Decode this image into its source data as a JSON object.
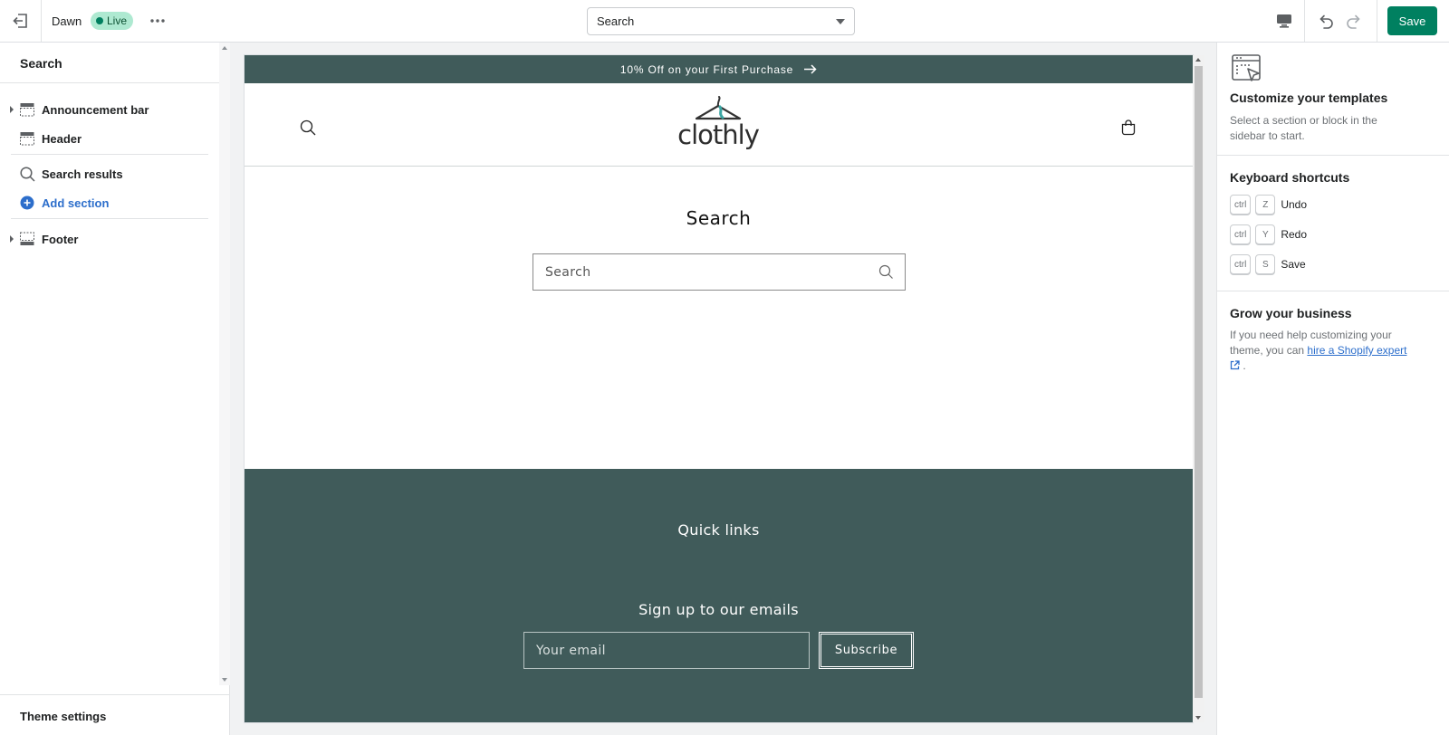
{
  "topbar": {
    "theme_name": "Dawn",
    "live_label": "Live",
    "page_select_value": "Search",
    "save_label": "Save"
  },
  "sidebar": {
    "title": "Search",
    "sections": [
      {
        "label": "Announcement bar",
        "icon": "section-header-icon"
      },
      {
        "label": "Header",
        "icon": "section-header-icon"
      },
      {
        "label": "Search results",
        "icon": "search-icon"
      },
      {
        "label": "Add section",
        "icon": "plus-circle-icon"
      },
      {
        "label": "Footer",
        "icon": "section-footer-icon"
      }
    ],
    "theme_settings_label": "Theme settings"
  },
  "preview": {
    "announcement": "10% Off on your First Purchase",
    "logo_text": "clothly",
    "search_title": "Search",
    "search_placeholder": "Search",
    "footer": {
      "quick_links": "Quick links",
      "signup_heading": "Sign up to our emails",
      "email_placeholder": "Your email",
      "subscribe_label": "Subscribe"
    }
  },
  "right_panel": {
    "customize_title": "Customize your templates",
    "customize_text": "Select a section or block in the sidebar to start.",
    "shortcuts_title": "Keyboard shortcuts",
    "shortcuts": [
      {
        "mod": "ctrl",
        "key": "Z",
        "action": "Undo"
      },
      {
        "mod": "ctrl",
        "key": "Y",
        "action": "Redo"
      },
      {
        "mod": "ctrl",
        "key": "S",
        "action": "Save"
      }
    ],
    "grow_title": "Grow your business",
    "grow_text_before": "If you need help customizing your theme, you can",
    "grow_link": "hire a Shopify expert",
    "grow_text_after": "."
  },
  "colors": {
    "accent_green": "#008060",
    "live_badge_bg": "#aee9d1",
    "store_teal": "#405b5a",
    "link_blue": "#2c6ecb"
  }
}
